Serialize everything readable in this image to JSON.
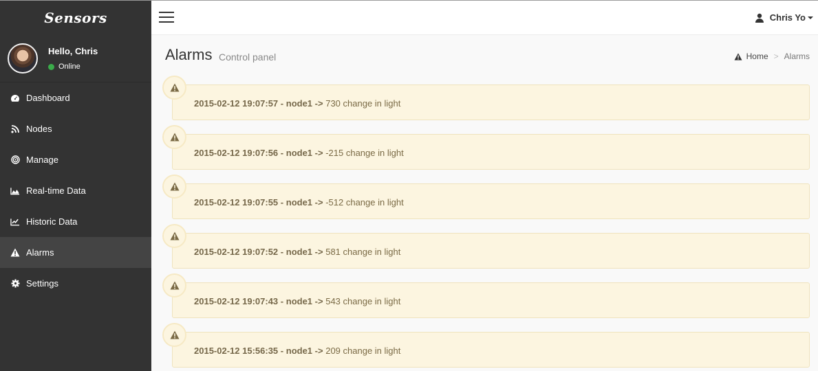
{
  "brand": "Sensors",
  "user": {
    "greeting": "Hello, Chris",
    "status": "Online",
    "menu_name": "Chris Yo"
  },
  "sidebar": {
    "items": [
      {
        "label": "Dashboard",
        "icon": "dashboard-icon"
      },
      {
        "label": "Nodes",
        "icon": "rss-icon"
      },
      {
        "label": "Manage",
        "icon": "target-icon"
      },
      {
        "label": "Real-time Data",
        "icon": "area-chart-icon"
      },
      {
        "label": "Historic Data",
        "icon": "line-chart-icon"
      },
      {
        "label": "Alarms",
        "icon": "warning-icon",
        "active": true
      },
      {
        "label": "Settings",
        "icon": "gear-icon"
      }
    ]
  },
  "page": {
    "title": "Alarms",
    "subtitle": "Control panel"
  },
  "breadcrumb": {
    "home": "Home",
    "separator": ">",
    "current": "Alarms"
  },
  "alarms": [
    {
      "timestamp": "2015-02-12 19:07:57",
      "node": "node1",
      "arrow": "->",
      "message": "730 change in light"
    },
    {
      "timestamp": "2015-02-12 19:07:56",
      "node": "node1",
      "arrow": "->",
      "message": "-215 change in light"
    },
    {
      "timestamp": "2015-02-12 19:07:55",
      "node": "node1",
      "arrow": "->",
      "message": "-512 change in light"
    },
    {
      "timestamp": "2015-02-12 19:07:52",
      "node": "node1",
      "arrow": "->",
      "message": "581 change in light"
    },
    {
      "timestamp": "2015-02-12 19:07:43",
      "node": "node1",
      "arrow": "->",
      "message": "543 change in light"
    },
    {
      "timestamp": "2015-02-12 15:56:35",
      "node": "node1",
      "arrow": "->",
      "message": "209 change in light"
    }
  ],
  "colors": {
    "sidebar_bg": "#333333",
    "sidebar_active": "#444444",
    "alarm_bg": "#fcf5e0",
    "alarm_text": "#7a6a45",
    "status_online": "#3aab4a"
  }
}
